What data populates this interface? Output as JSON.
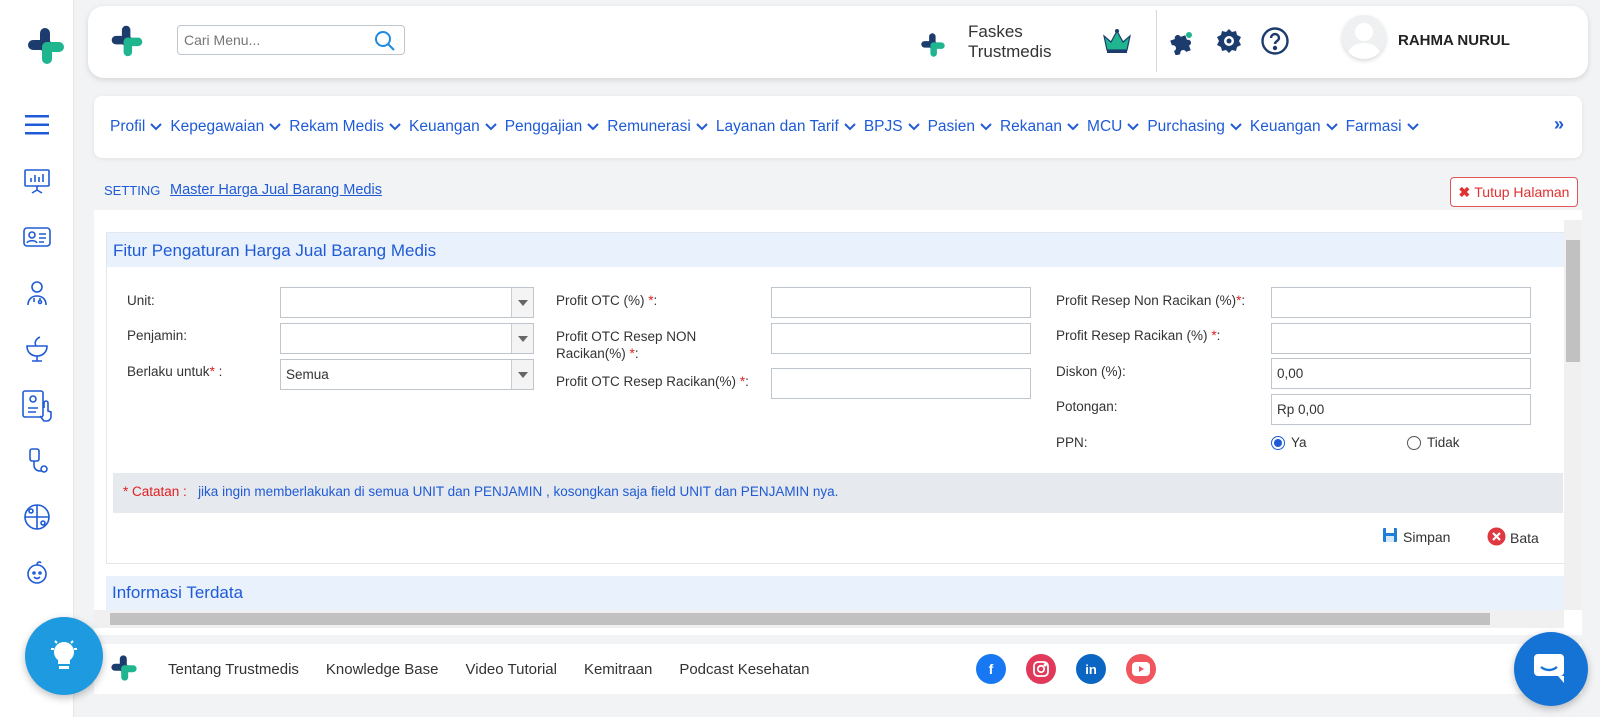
{
  "header": {
    "search_placeholder": "Cari Menu...",
    "faskes_name": "Faskes Trustmedis",
    "username": "RAHMA NURUL"
  },
  "nav": {
    "items": [
      {
        "label": "Profil"
      },
      {
        "label": "Kepegawaian"
      },
      {
        "label": "Rekam Medis"
      },
      {
        "label": "Keuangan"
      },
      {
        "label": "Penggajian"
      },
      {
        "label": "Remunerasi"
      },
      {
        "label": "Layanan dan Tarif"
      },
      {
        "label": "BPJS"
      },
      {
        "label": "Pasien"
      },
      {
        "label": "Rekanan"
      },
      {
        "label": "MCU"
      },
      {
        "label": "Purchasing"
      },
      {
        "label": "Keuangan"
      },
      {
        "label": "Farmasi"
      }
    ],
    "more": "»"
  },
  "breadcrumb": {
    "section": "SETTING",
    "page": "Master Harga Jual Barang Medis"
  },
  "close_button": "Tutup Halaman",
  "form": {
    "title": "Fitur Pengaturan Harga Jual Barang Medis",
    "unit_label": "Unit:",
    "unit_value": "",
    "penjamin_label": "Penjamin:",
    "penjamin_value": "",
    "berlaku_label": "Berlaku untuk",
    "berlaku_value": "Semua",
    "profit_otc_label": "Profit OTC (%)",
    "profit_otc_non_label": "Profit OTC Resep NON Racikan(%)",
    "profit_otc_racikan_label": "Profit OTC Resep Racikan(%)",
    "profit_non_racikan_label": "Profit Resep Non Racikan (%)",
    "profit_racikan_label": "Profit Resep Racikan (%)",
    "diskon_label": "Diskon (%):",
    "diskon_value": "0,00",
    "potongan_label": "Potongan:",
    "potongan_value": "Rp 0,00",
    "ppn_label": "PPN:",
    "ppn_options": [
      "Ya",
      "Tidak"
    ],
    "ppn_selected": "Ya",
    "note_prefix": "* Catatan :",
    "note_text": "jika ingin memberlakukan di semua UNIT dan PENJAMIN , kosongkan saja field UNIT dan PENJAMIN nya.",
    "save_label": "Simpan",
    "cancel_label": "Bata"
  },
  "section2_title": "Informasi Terdata",
  "footer": {
    "links": [
      "Tentang Trustmedis",
      "Knowledge Base",
      "Video Tutorial",
      "Kemitraan",
      "Podcast Kesehatan"
    ]
  },
  "colors": {
    "brand_blue": "#1f5bd6",
    "brand_green": "#1fb58f",
    "navy": "#1d3c6e",
    "danger": "#e03030"
  }
}
